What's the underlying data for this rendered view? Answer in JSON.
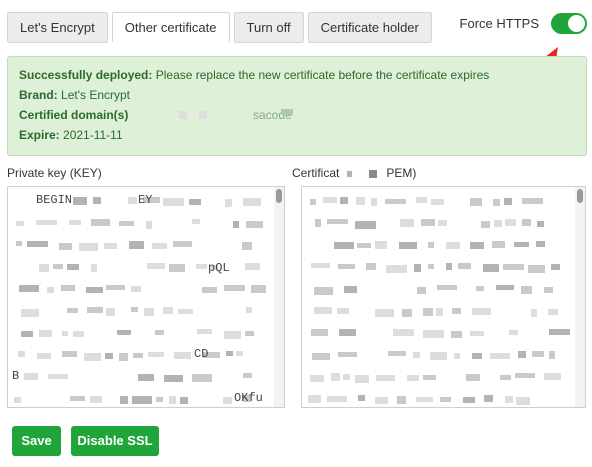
{
  "tabs": [
    "Let's Encrypt",
    "Other certificate",
    "Turn off",
    "Certificate holder"
  ],
  "active_tab": "Other certificate",
  "force_https": {
    "label": "Force HTTPS",
    "enabled": true
  },
  "alert": {
    "status_label": "Successfully deployed:",
    "status_text": "Please replace the new certificate before the certificate expires",
    "brand_label": "Brand:",
    "brand_value": "Let's Encrypt",
    "domains_label": "Certified domain(s)",
    "domains_value_fragment": "sacode",
    "expire_label": "Expire:",
    "expire_value": "2021-11-11"
  },
  "private_key": {
    "label": "Private key (KEY)",
    "visible_fragments": [
      "BEGIN",
      "EY",
      "pQL",
      "CD",
      "B",
      "OKfu"
    ]
  },
  "certificate": {
    "label_start": "Certificat",
    "label_end": "PEM)"
  },
  "buttons": {
    "save": "Save",
    "disable_ssl": "Disable SSL"
  },
  "colors": {
    "accent": "#20a53a",
    "alert_bg": "#dff0d8",
    "alert_text": "#2a6a2c",
    "arrow": "#e8261a"
  }
}
